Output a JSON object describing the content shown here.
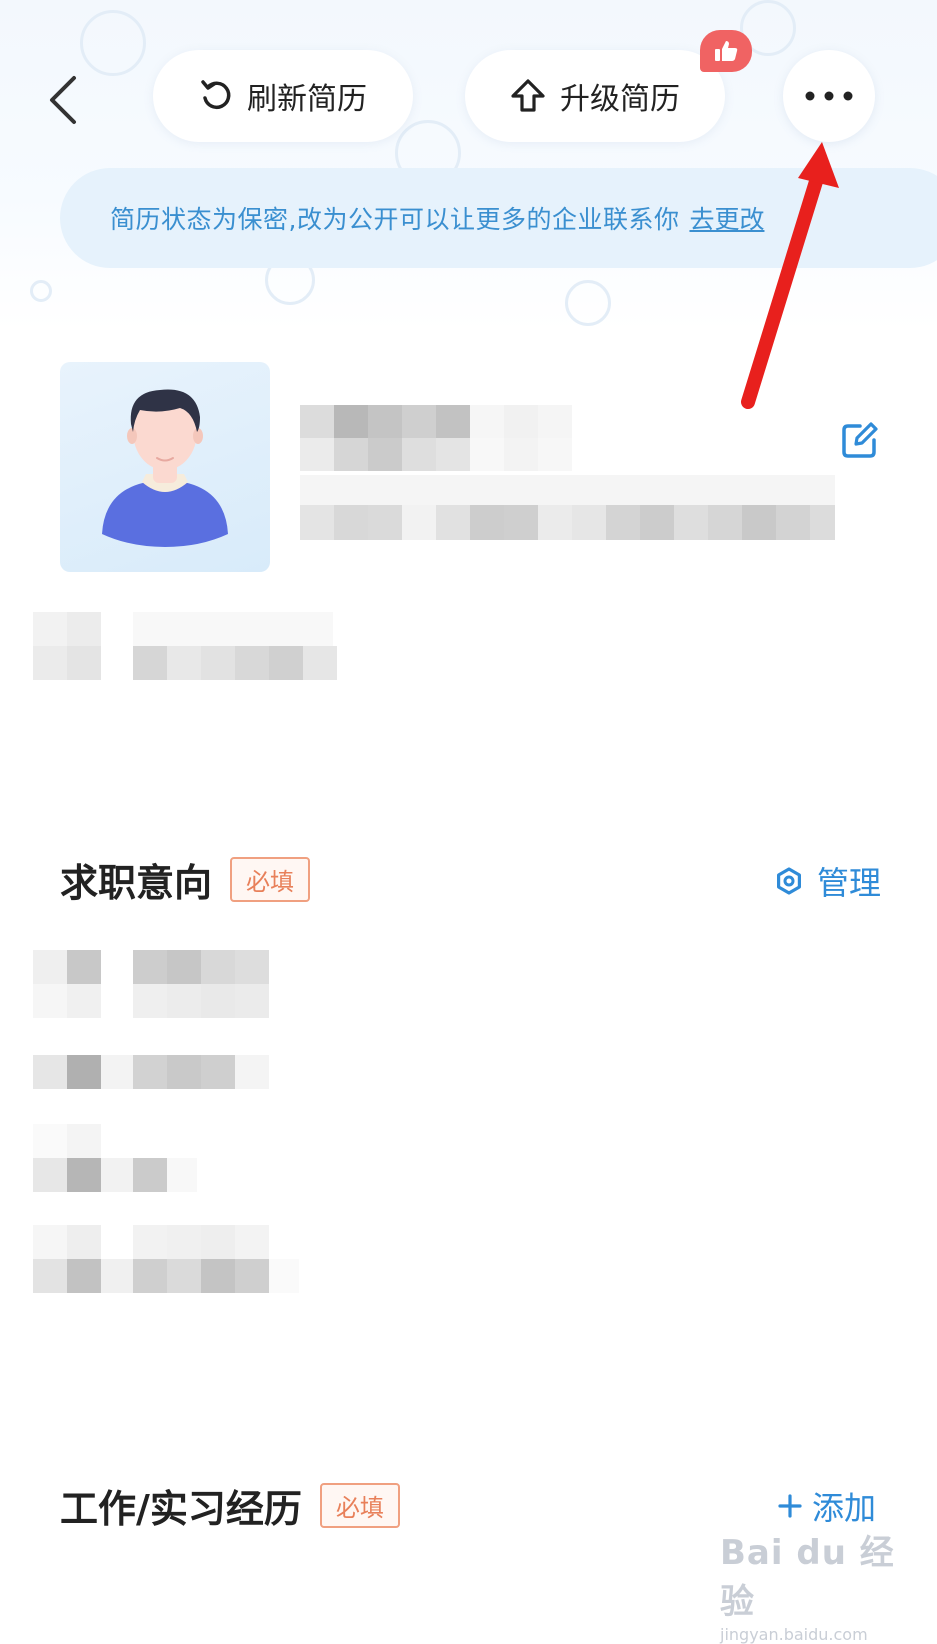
{
  "header": {
    "refresh_label": "刷新简历",
    "upgrade_label": "升级简历"
  },
  "notice": {
    "text": "简历状态为保密,改为公开可以让更多的企业联系你",
    "link": "去更改"
  },
  "sections": {
    "intent": {
      "title": "求职意向",
      "badge": "必填",
      "action": "管理"
    },
    "experience": {
      "title": "工作/实习经历",
      "badge": "必填",
      "action": "添加"
    }
  },
  "watermark": {
    "line1": "Bai du 经验",
    "line2": "jingyan.baidu.com"
  },
  "colors": {
    "accent": "#2f8bd8",
    "badge": "#e8805a",
    "arrow": "#e8201d"
  }
}
